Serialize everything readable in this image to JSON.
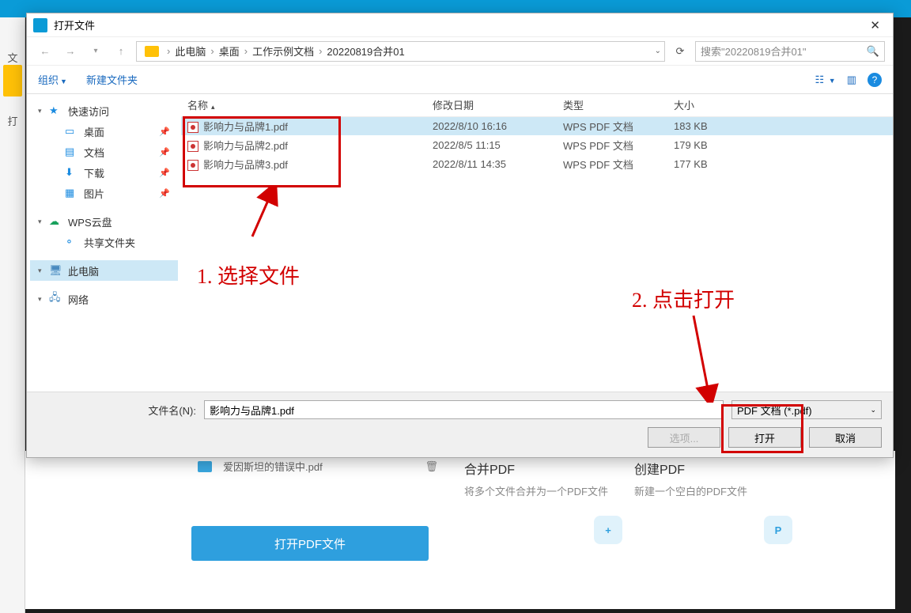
{
  "app": {
    "leftLabels": [
      "文",
      "打"
    ]
  },
  "behind": {
    "recent": "爱因斯坦的错误中.pdf",
    "openBtn": "打开PDF文件",
    "cards": [
      {
        "title": "合并PDF",
        "desc": "将多个文件合并为一个PDF文件",
        "badge": "+"
      },
      {
        "title": "创建PDF",
        "desc": "新建一个空白的PDF文件",
        "badge": "P"
      }
    ]
  },
  "dlg": {
    "title": "打开文件",
    "breadcrumb": [
      "此电脑",
      "桌面",
      "工作示例文档",
      "20220819合并01"
    ],
    "searchPlaceholder": "搜索\"20220819合并01\"",
    "organize": "组织",
    "newFolder": "新建文件夹"
  },
  "side": [
    {
      "label": "快速访问",
      "icon": "★",
      "color": "#1a8be0",
      "expand": true
    },
    {
      "label": "桌面",
      "icon": "▭",
      "color": "#1a8be0",
      "indent": true,
      "pin": true
    },
    {
      "label": "文档",
      "icon": "▤",
      "color": "#1a8be0",
      "indent": true,
      "pin": true
    },
    {
      "label": "下载",
      "icon": "⬇",
      "color": "#1a8be0",
      "indent": true,
      "pin": true
    },
    {
      "label": "图片",
      "icon": "▦",
      "color": "#1a8be0",
      "indent": true,
      "pin": true
    },
    {
      "label": "WPS云盘",
      "icon": "☁",
      "color": "#17a05b",
      "expand": true,
      "gap": true
    },
    {
      "label": "共享文件夹",
      "icon": "⚬",
      "color": "#1a8be0",
      "indent": true
    },
    {
      "label": "此电脑",
      "icon": "🖥",
      "color": "#4a8bc0",
      "expand": true,
      "sel": true,
      "gap": true
    },
    {
      "label": "网络",
      "icon": "🖧",
      "color": "#4a8bc0",
      "expand": true,
      "gap": true
    }
  ],
  "columns": {
    "name": "名称",
    "date": "修改日期",
    "type": "类型",
    "size": "大小"
  },
  "files": [
    {
      "name": "影响力与品牌1.pdf",
      "date": "2022/8/10 16:16",
      "type": "WPS PDF 文档",
      "size": "183 KB",
      "sel": true
    },
    {
      "name": "影响力与品牌2.pdf",
      "date": "2022/8/5 11:15",
      "type": "WPS PDF 文档",
      "size": "179 KB"
    },
    {
      "name": "影响力与品牌3.pdf",
      "date": "2022/8/11 14:35",
      "type": "WPS PDF 文档",
      "size": "177 KB"
    }
  ],
  "footer": {
    "fileLabel": "文件名(N):",
    "fileName": "影响力与品牌1.pdf",
    "filter": "PDF 文档 (*.pdf)",
    "options": "选项...",
    "open": "打开",
    "cancel": "取消"
  },
  "anno": {
    "a1": "1. 选择文件",
    "a2": "2. 点击打开"
  }
}
